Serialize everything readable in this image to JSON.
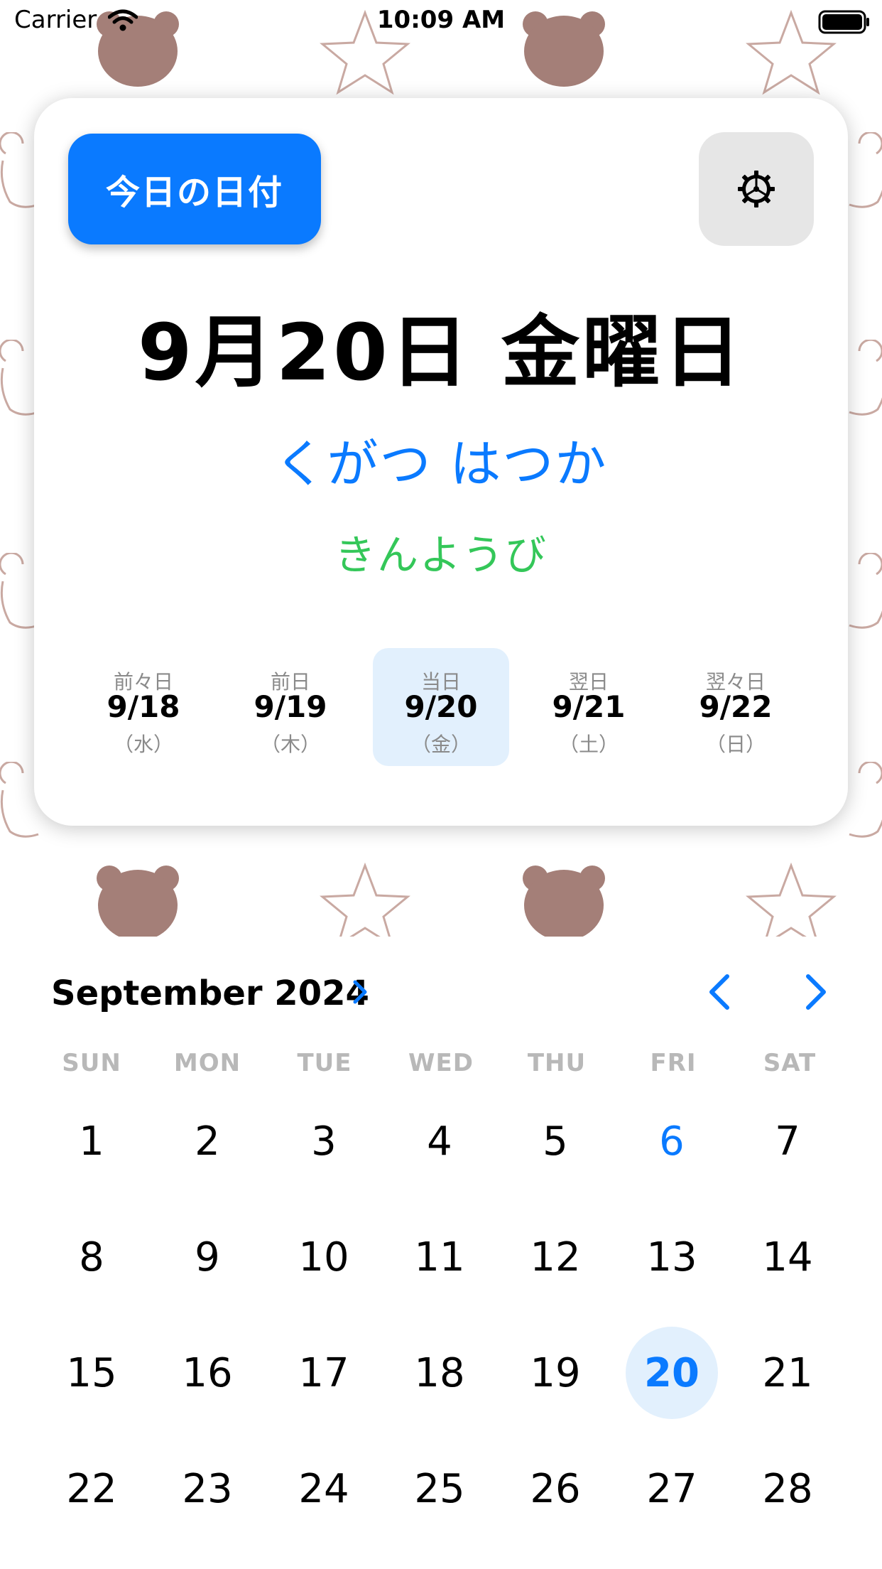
{
  "status_bar": {
    "carrier": "Carrier",
    "time": "10:09 AM",
    "wifi_icon": "wifi-icon",
    "battery_icon": "battery-full-icon"
  },
  "card": {
    "today_button_label": "今日の日付",
    "settings_icon": "gear-icon",
    "main_date": "9月20日 金曜日",
    "date_reading": "くがつ はつか",
    "weekday_reading": "きんようび",
    "colors": {
      "accent": "#0a7aff",
      "weekday_reading": "#34c759",
      "selected_background": "#e2f0fd",
      "settings_background": "#e6e6e6"
    },
    "days": [
      {
        "label": "前々日",
        "date": "9/18",
        "weekday": "（水）",
        "selected": false
      },
      {
        "label": "前日",
        "date": "9/19",
        "weekday": "（木）",
        "selected": false
      },
      {
        "label": "当日",
        "date": "9/20",
        "weekday": "（金）",
        "selected": true
      },
      {
        "label": "翌日",
        "date": "9/21",
        "weekday": "（土）",
        "selected": false
      },
      {
        "label": "翌々日",
        "date": "9/22",
        "weekday": "（日）",
        "selected": false
      }
    ]
  },
  "calendar": {
    "month_title": "September 2024",
    "month_picker_icon": "chevron-right-icon",
    "prev_icon": "chevron-left-icon",
    "next_icon": "chevron-right-icon",
    "weekdays": [
      "SUN",
      "MON",
      "TUE",
      "WED",
      "THU",
      "FRI",
      "SAT"
    ],
    "weeks": [
      [
        "1",
        "2",
        "3",
        "4",
        "5",
        "6",
        "7"
      ],
      [
        "8",
        "9",
        "10",
        "11",
        "12",
        "13",
        "14"
      ],
      [
        "15",
        "16",
        "17",
        "18",
        "19",
        "20",
        "21"
      ],
      [
        "22",
        "23",
        "24",
        "25",
        "26",
        "27",
        "28"
      ]
    ],
    "today_day": "6",
    "selected_day": "20"
  }
}
